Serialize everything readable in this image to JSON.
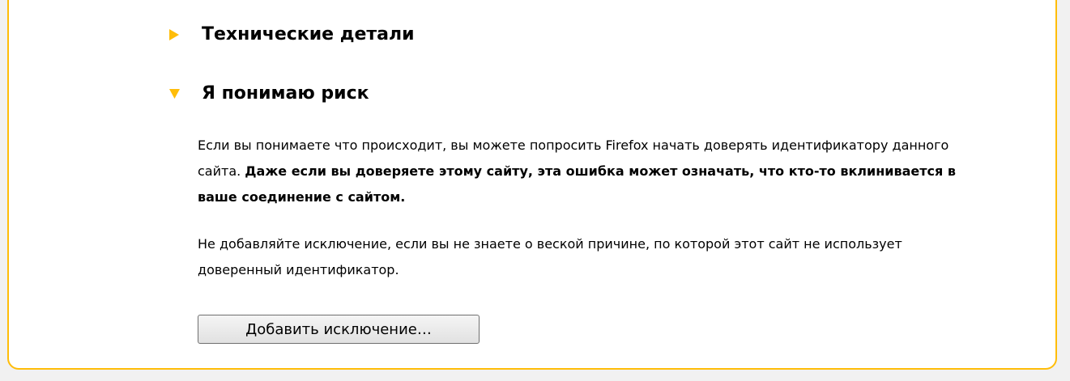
{
  "colors": {
    "accent": "#ffbd09",
    "page_background": "#f1f1f1",
    "panel_background": "#ffffff"
  },
  "sections": [
    {
      "title": "Технические детали",
      "expanded": false,
      "arrow_icon": "triangle-right-icon"
    },
    {
      "title": "Я понимаю риск",
      "expanded": true,
      "arrow_icon": "triangle-down-icon"
    }
  ],
  "risk": {
    "paragraph1_normal": "Если вы понимаете что происходит, вы можете попросить Firefox начать доверять идентификатору данного сайта. ",
    "paragraph1_bold": "Даже если вы доверяете этому сайту, эта ошибка может означать, что кто-то вклинивается в ваше соединение с сайтом.",
    "paragraph2": "Не добавляйте исключение, если вы не знаете о веской причине, по которой этот сайт не использует доверенный идентификатор.",
    "add_exception_button": "Добавить исключение…"
  }
}
